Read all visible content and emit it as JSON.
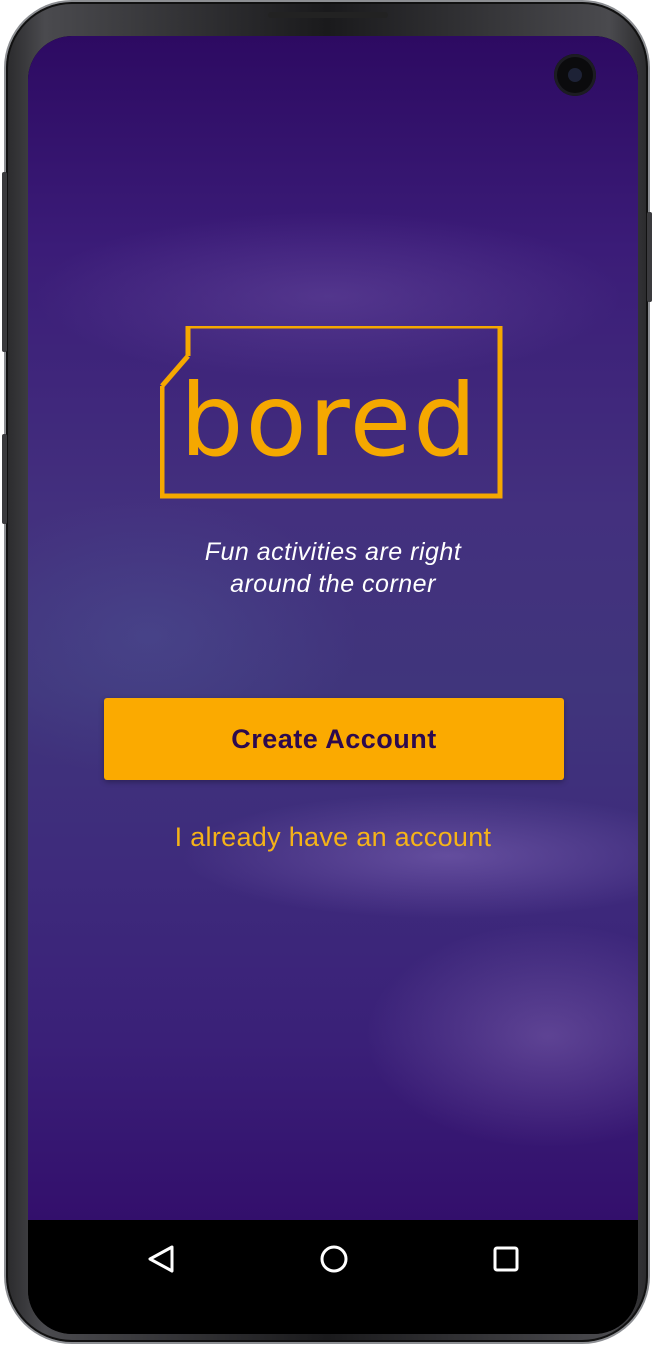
{
  "app": {
    "logo_text": "bored",
    "tagline_line1": "Fun activities are right",
    "tagline_line2": "around the corner",
    "create_account_label": "Create Account",
    "login_link_label": "I already have an account"
  },
  "navigation_bar": {
    "back_icon": "triangle-back-icon",
    "home_icon": "circle-home-icon",
    "recent_icon": "square-recents-icon"
  },
  "colors": {
    "accent": "#fbaa00",
    "button_text": "#2d0a4e",
    "background_top": "#2d0a62",
    "background_mid": "#43307e"
  }
}
